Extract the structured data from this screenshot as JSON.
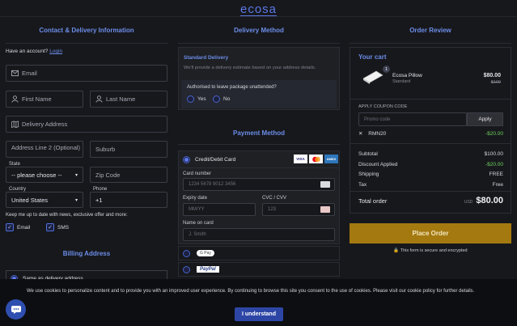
{
  "brand": {
    "logo": "ecosa"
  },
  "contact": {
    "heading": "Contact & Delivery Information",
    "have_account": "Have an account?",
    "login": "Login",
    "email_placeholder": "Email",
    "first_name_placeholder": "First Name",
    "last_name_placeholder": "Last Name",
    "address_placeholder": "Delivery Address",
    "address2_placeholder": "Address Line 2 (Optional)",
    "suburb_placeholder": "Suburb",
    "state_label": "State",
    "state_value": "-- please choose --",
    "zip_placeholder": "Zip Code",
    "country_label": "Country",
    "country_value": "United States",
    "phone_label": "Phone",
    "phone_value": "+1",
    "newsletter_text": "Keep me up to date with news, exclusive offer and more:",
    "opt_email": "Email",
    "opt_sms": "SMS"
  },
  "billing": {
    "heading": "Billing Address",
    "same_as_delivery": "Same as delivery address"
  },
  "delivery": {
    "heading": "Delivery Method",
    "standard_title": "Standard Delivery",
    "standard_desc": "We'll provide a delivery estimate based on your address details.",
    "authorised_q": "Authorised to leave package unattended?",
    "yes": "Yes",
    "no": "No"
  },
  "payment": {
    "heading": "Payment Method",
    "card_option": "Credit/Debit Card",
    "card_brands": [
      "VISA",
      "MC",
      "AMEX"
    ],
    "card_number_label": "Card number",
    "card_number_placeholder": "1234 5678 9012 3456",
    "expiry_label": "Expiry date",
    "expiry_placeholder": "MM/YY",
    "cvc_label": "CVC / CVV",
    "cvc_placeholder": "123",
    "name_label": "Name on card",
    "name_placeholder": "J. Smith",
    "gpay": "G Pay",
    "paypal": "PayPal"
  },
  "order": {
    "heading": "Order Review",
    "cart_title": "Your cart",
    "item_name": "Ecosa Pillow",
    "item_variant": "Standard",
    "item_qty": "1",
    "item_price": "$80.00",
    "item_old_price": "$100",
    "coupon_label": "APPLY COUPON CODE",
    "coupon_placeholder": "Promo code",
    "apply_label": "Apply",
    "applied_code": "RMN20",
    "applied_discount": "-$20.00",
    "subtotal_label": "Subtotal",
    "subtotal_value": "$100.00",
    "discount_label": "Discount Applied",
    "discount_value": "-$20.00",
    "shipping_label": "Shipping",
    "shipping_value": "FREE",
    "tax_label": "Tax",
    "tax_value": "Free",
    "total_label": "Total order",
    "total_currency": "USD",
    "total_value": "$80.00",
    "place_order": "Place Order",
    "secure_text": "This form is secure and encrypted"
  },
  "cookie": {
    "text": "We use cookies to personalize content and to provide you with an improved user experience. By continuing to browse this site you consent to the use of cookies. Please visit our cookie policy for further details.",
    "button": "I understand"
  },
  "colors": {
    "accent": "#6c8de8",
    "place_order": "#a47a10",
    "discount": "#6fd35f",
    "background": "#17181c"
  }
}
